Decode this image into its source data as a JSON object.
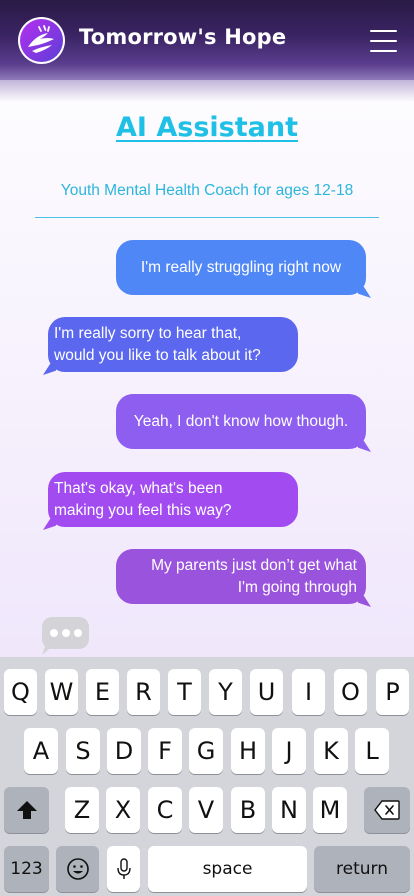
{
  "header": {
    "brand": "Tomorrow's Hope",
    "logo_icon": "hands-logo-icon",
    "menu_icon": "hamburger-menu-icon",
    "colors": {
      "header_dark": "#2a1a45",
      "header_light": "#8f7ab8"
    }
  },
  "page": {
    "title": "AI Assistant",
    "subtitle": "Youth Mental Health Coach for ages 12-18",
    "accent": "#1ec0e6"
  },
  "chat": {
    "messages": [
      {
        "side": "user",
        "lines": [
          "I'm really struggling right now"
        ],
        "color": "#4f87f6"
      },
      {
        "side": "assistant",
        "lines": [
          "I'm really sorry to hear that,",
          "would you like to talk about it?"
        ],
        "color": "#5a67ee"
      },
      {
        "side": "user",
        "lines": [
          "Yeah, I don't know how though."
        ],
        "color": "#8d5ef0"
      },
      {
        "side": "assistant",
        "lines": [
          "That's okay, what's been",
          "making you feel this way?"
        ],
        "color": "#a24bf0"
      },
      {
        "side": "user",
        "lines": [
          "My parents just don’t get what",
          "I'm going through"
        ],
        "color": "#9a53dc"
      }
    ],
    "typing_indicator_icon": "typing-dots-icon"
  },
  "keyboard": {
    "row1": [
      "Q",
      "W",
      "E",
      "R",
      "T",
      "Y",
      "U",
      "I",
      "O",
      "P"
    ],
    "row2": [
      "A",
      "S",
      "D",
      "F",
      "G",
      "H",
      "J",
      "K",
      "L"
    ],
    "row3": [
      "Z",
      "X",
      "C",
      "V",
      "B",
      "N",
      "M"
    ],
    "shift_icon": "shift-arrow-icon",
    "delete_icon": "backspace-icon",
    "numbers_label": "123",
    "emoji_icon": "emoji-icon",
    "mic_icon": "microphone-icon",
    "space_label": "space",
    "return_label": "return"
  }
}
